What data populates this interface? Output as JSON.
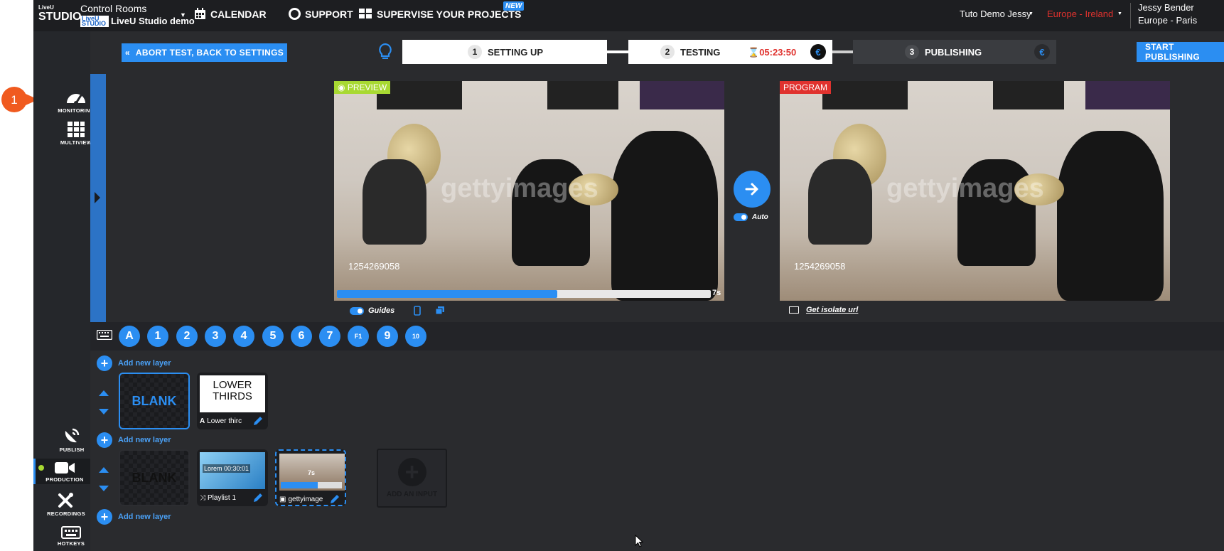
{
  "header": {
    "logo_top": "LiveU",
    "logo_bottom": "STUDIO",
    "control_rooms": "Control Rooms",
    "studio_mini_logo": "LiveU STUDIO",
    "studio_name": "LiveU Studio demo",
    "nav": {
      "calendar": "CALENDAR",
      "support": "SUPPORT",
      "supervise": "SUPERVISE YOUR PROJECTS",
      "new_badge": "NEW"
    },
    "account": "Tuto Demo Jessy",
    "region": "Europe - Ireland",
    "user_name": "Jessy Bender",
    "user_timezone": "Europe - Paris"
  },
  "sidebar": {
    "callout_number": "1",
    "items": {
      "monitoring": "MONITORING",
      "multiview": "MULTIVIEW",
      "publish": "PUBLISH",
      "production": "PRODUCTION",
      "recordings": "RECORDINGS",
      "hotkeys": "HOTKEYS"
    }
  },
  "stepbar": {
    "abort_label": "ABORT TEST, BACK TO SETTINGS",
    "steps": [
      {
        "num": "1",
        "label": "SETTING UP"
      },
      {
        "num": "2",
        "label": "TESTING"
      },
      {
        "num": "3",
        "label": "PUBLISHING"
      }
    ],
    "timer": "05:23:50",
    "euro_symbol": "€",
    "start_label": "START PUBLISHING"
  },
  "preview": {
    "tag": "PREVIEW",
    "watermark": "gettyimages",
    "video_id": "1254269058",
    "remaining": "7s",
    "progress_fraction": 0.59,
    "guides_label": "Guides"
  },
  "program": {
    "tag": "PROGRAM",
    "watermark": "gettyimages",
    "video_id": "1254269058",
    "isolate_label": "Get isolate url"
  },
  "transition": {
    "auto_label": "Auto"
  },
  "hotkeys": [
    "A",
    "1",
    "2",
    "3",
    "4",
    "5",
    "6",
    "7",
    "F1",
    "9",
    "10"
  ],
  "layers": {
    "add_layer_label": "Add new layer",
    "layer1": {
      "blank_label": "BLANK",
      "lower_thirds_thumb": "LOWER THIRDS",
      "lower_thirds_caption": "Lower thirc"
    },
    "layer2": {
      "blank_label": "BLANK",
      "playlist_thumb": "Lorem 00:30:01",
      "playlist_caption": "Playlist 1",
      "getty_caption": "gettyimage",
      "getty_time": "7s",
      "add_input_label": "ADD AN INPUT"
    }
  },
  "colors": {
    "accent": "#2b8ef2",
    "danger": "#e0322e",
    "preview_tag": "#a8d932",
    "topbar": "#1d1e21"
  }
}
